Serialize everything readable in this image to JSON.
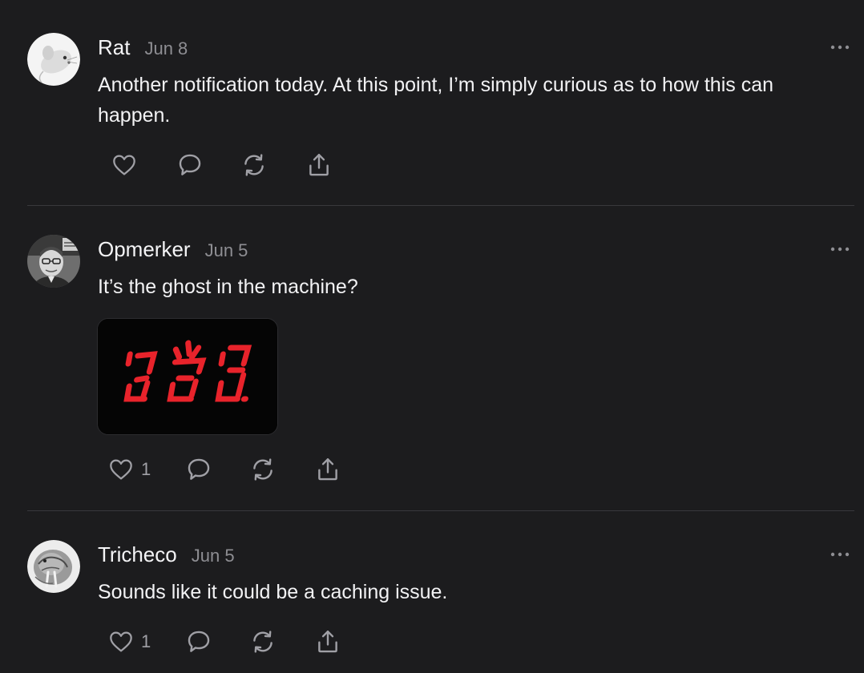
{
  "posts": [
    {
      "author": "Rat",
      "date": "Jun 8",
      "text": "Another notification today. At this point, I’m simply curious as to how this can happen.",
      "avatar_icon": "rat-avatar",
      "like_count": ""
    },
    {
      "author": "Opmerker",
      "date": "Jun 5",
      "text": "It’s the ghost in the machine?",
      "avatar_icon": "person-photo-avatar",
      "attachment_icon": "red-seven-segment-digits-image",
      "like_count": "1"
    },
    {
      "author": "Tricheco",
      "date": "Jun 5",
      "text": "Sounds like it could be a caching issue.",
      "avatar_icon": "walrus-avatar",
      "like_count": "1"
    }
  ],
  "colors": {
    "background": "#1c1c1e",
    "text_primary": "#f2f2f4",
    "text_secondary": "#8e8e93",
    "icon": "#a0a0a6",
    "divider": "#38383c",
    "digit_red": "#e8232b"
  },
  "icons": [
    "heart-icon",
    "comment-icon",
    "repost-icon",
    "share-icon",
    "more-options-icon"
  ]
}
